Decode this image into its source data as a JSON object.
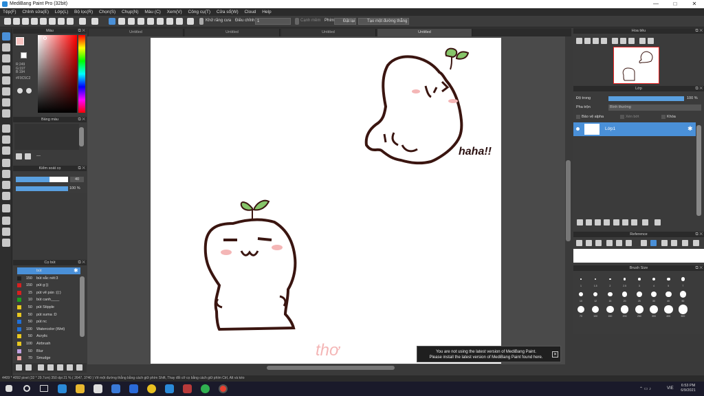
{
  "window": {
    "title": "MediBang Paint Pro (32bit)",
    "min": "—",
    "max": "□",
    "close": "✕"
  },
  "menu": [
    "Tệp(F)",
    "Chỉnh sửa(E)",
    "Lớp(L)",
    "Bộ lọc(R)",
    "Chọn(S)",
    "Chụp(N)",
    "Màu (C)",
    "Xem(V)",
    "Công cụ(T)",
    "Cửa sổ(W)",
    "Cloud",
    "Help"
  ],
  "toolbar": {
    "antialias_label": "Khử răng cưa",
    "correction_label": "Điều chỉnh",
    "correction_value": "1",
    "edge_label": "Cạnh mềm",
    "key_label": "Phím",
    "cancel_label": "Đặt lại",
    "perspective_label": "Tạo một đường thẳng"
  },
  "tabs": [
    "Untitled",
    "Untitled",
    "Untitled",
    "Untitled"
  ],
  "color_panel": {
    "title": "Màu",
    "r": "R:249",
    "g": "G:197",
    "b": "B:194",
    "hex": "#F9C5C2",
    "primary_color": "#f9c5c2"
  },
  "palette_panel": {
    "title": "Bảng màu",
    "dash": "---"
  },
  "brush_control": {
    "title": "Kiểm soát cọ",
    "size_value": "40",
    "opacity_value": "100 %"
  },
  "brush_panel": {
    "title": "Cọ bút",
    "items": [
      {
        "num": "",
        "label": "bút",
        "color": "#4a90d8"
      },
      {
        "num": "150",
        "label": "bút sắc nét:3",
        "color": "#222222"
      },
      {
        "num": "150",
        "label": "pút g:))",
        "color": "#d82020"
      },
      {
        "num": "15",
        "label": "pút vẽ pán :((:)",
        "color": "#d82020"
      },
      {
        "num": "10",
        "label": "bút canh____",
        "color": "#20a020"
      },
      {
        "num": "50",
        "label": "pút Stipple",
        "color": "#e8c820"
      },
      {
        "num": "50",
        "label": "pút suma :D",
        "color": "#e8c820"
      },
      {
        "num": "50",
        "label": "pút nc",
        "color": "#2070d8"
      },
      {
        "num": "100",
        "label": "Watercolor (Wet)",
        "color": "#2070d8"
      },
      {
        "num": "50",
        "label": "Acrylic",
        "color": "#e8c820"
      },
      {
        "num": "100",
        "label": "Airbrush",
        "color": "#e8c820"
      },
      {
        "num": "50",
        "label": "Blur",
        "color": "#c0a0e0"
      },
      {
        "num": "70",
        "label": "Smudge",
        "color": "#e8a0a0"
      }
    ]
  },
  "navigator": {
    "title": "Hoa tiêu"
  },
  "layer_panel": {
    "title": "Lớp",
    "opacity_label": "Độ trong",
    "opacity_value": "100 %",
    "blend_label": "Pha trộn",
    "blend_value": "Bình thường",
    "protect_alpha": "Bảo vệ alpha",
    "clipping": "Xén bớt",
    "lock": "Khóa",
    "layer_name": "Lớp1"
  },
  "reference_panel": {
    "title": "Reference"
  },
  "brush_size_panel": {
    "title": "Brush Size",
    "labels": [
      "1",
      "1.5",
      "2",
      "2.5",
      "3",
      "4",
      "5",
      "7",
      "10",
      "12",
      "15",
      "20",
      "25",
      "30",
      "40",
      "50",
      "70",
      "100",
      "150",
      "200",
      "250",
      "300",
      "400",
      "500"
    ]
  },
  "canvas": {
    "haha_text": "haha!!",
    "tho_text": "thơ"
  },
  "notification": {
    "line1": "You are not using the latest version of MediBang Paint.",
    "line2": "Please install the latest version of MediBang Paint found here.",
    "close": "✕"
  },
  "status": "4409 * 4092 pixel  (32 * 29.7cm)  350 dpi  21 %  ( 2647, 3740 )  Vẽ một đường thẳng bằng cách giữ phím Shift, Thay đổi cỡ cọ bằng cách giữ phím Ctrl, Alt và kéo",
  "taskbar": {
    "lang": "VIE",
    "time": "6:53 PM",
    "date": "6/9/2021"
  }
}
